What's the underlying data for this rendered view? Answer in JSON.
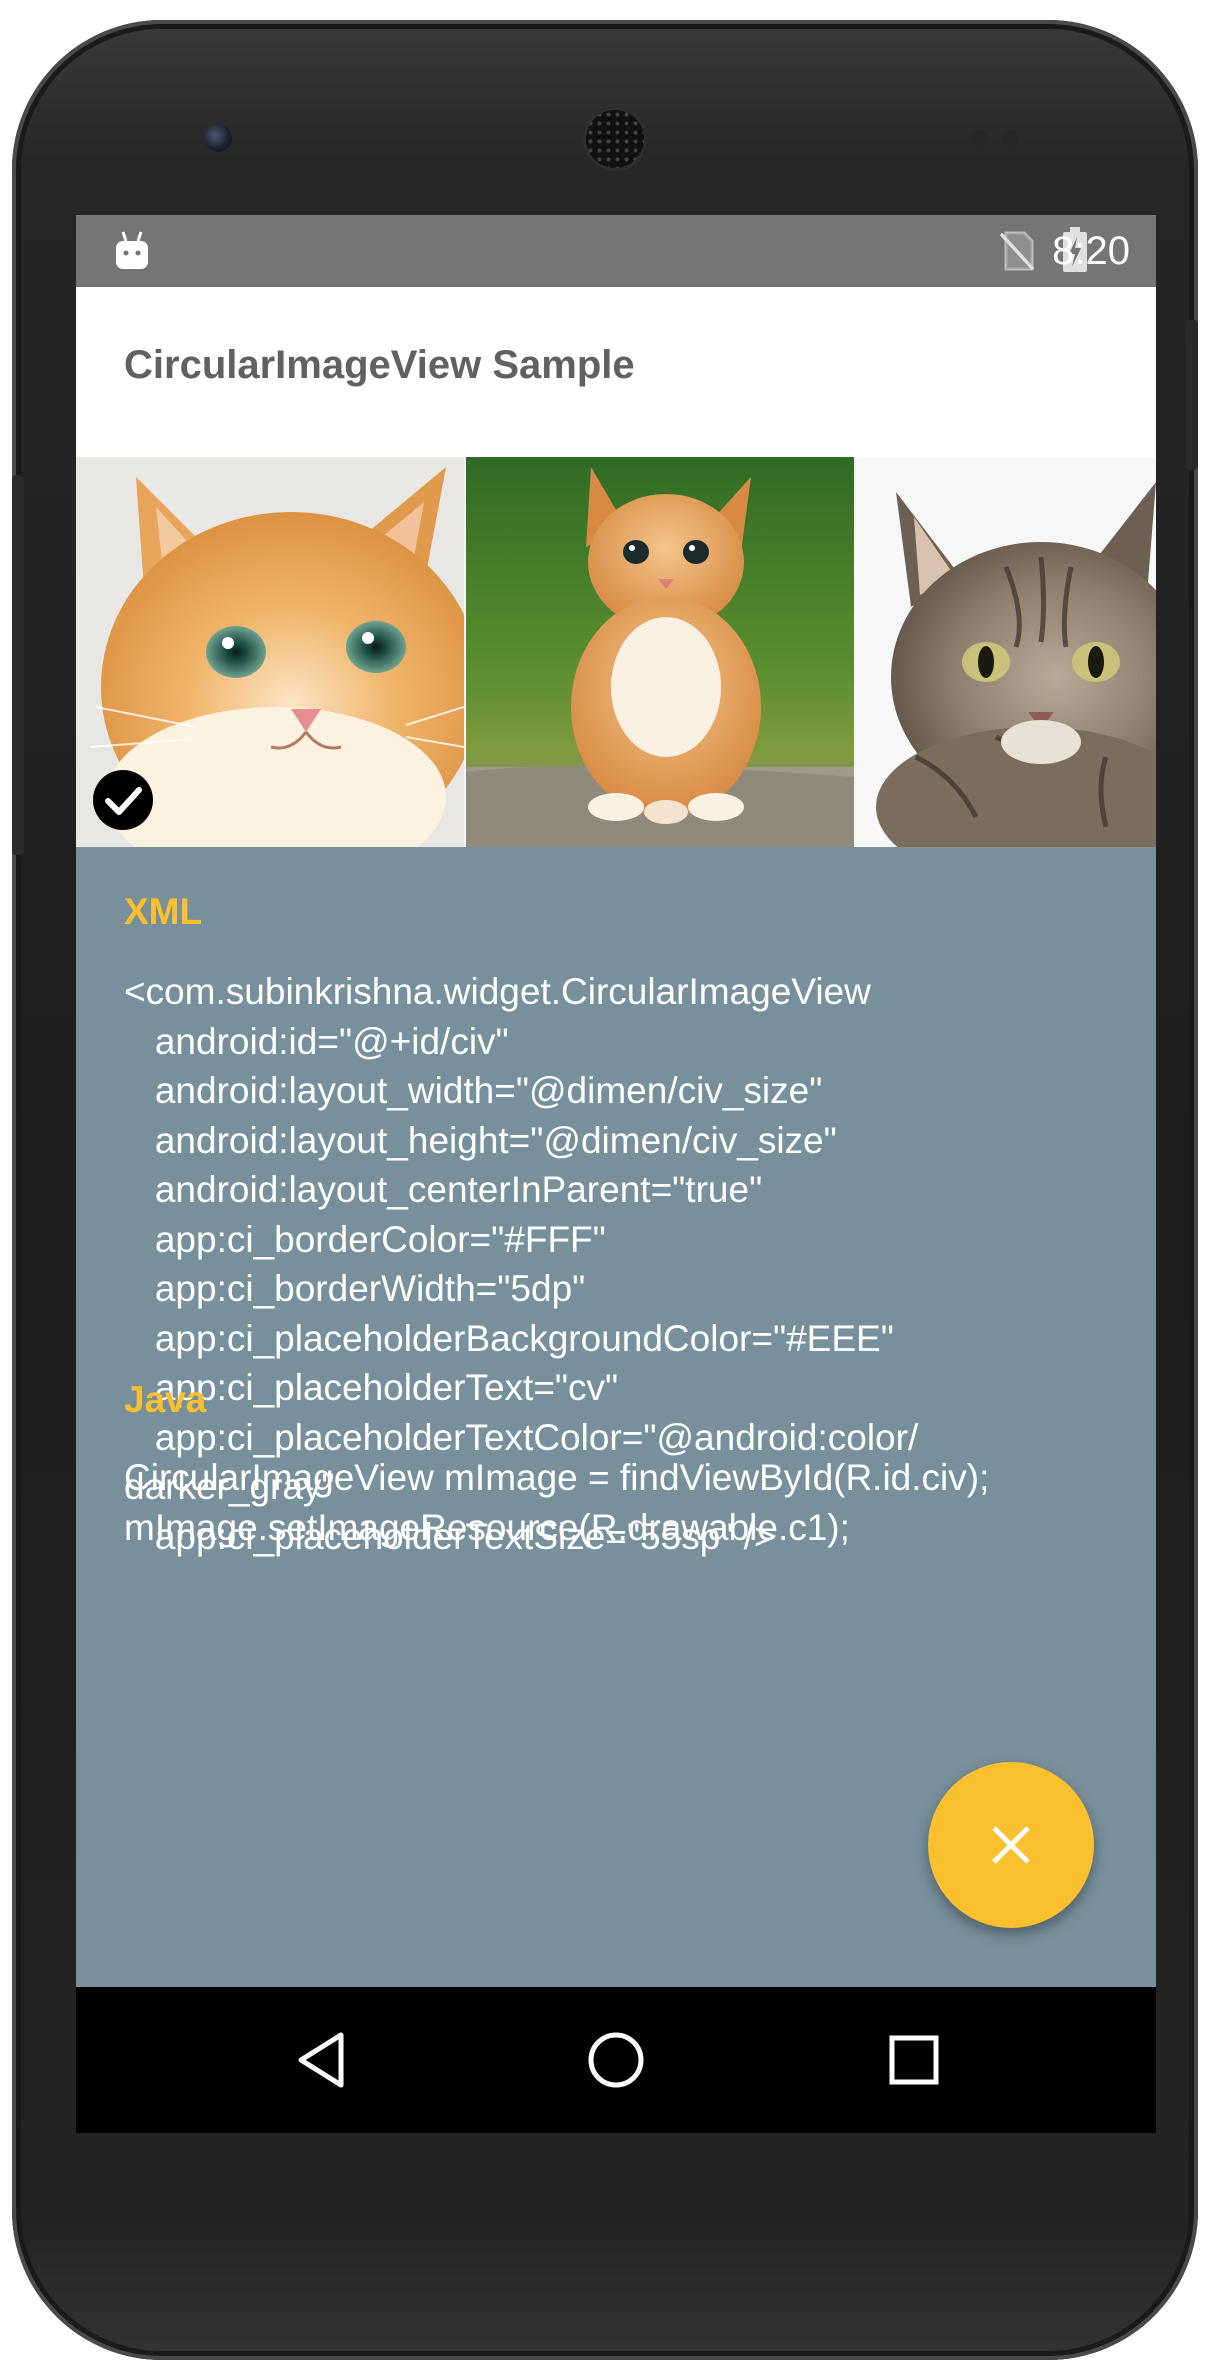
{
  "status_bar": {
    "time": "8:20"
  },
  "app_bar": {
    "title": "CircularImageView Sample"
  },
  "gallery": {
    "items": [
      {
        "subject": "orange kitten close-up",
        "selected": true
      },
      {
        "subject": "orange kitten sitting on grass",
        "selected": false
      },
      {
        "subject": "tabby cat",
        "selected": false
      }
    ]
  },
  "xml_section": {
    "title": "XML",
    "code": "<com.subinkrishna.widget.CircularImageView\n   android:id=\"@+id/civ\"\n   android:layout_width=\"@dimen/civ_size\"\n   android:layout_height=\"@dimen/civ_size\"\n   android:layout_centerInParent=\"true\"\n   app:ci_borderColor=\"#FFF\"\n   app:ci_borderWidth=\"5dp\"\n   app:ci_placeholderBackgroundColor=\"#EEE\"\n   app:ci_placeholderText=\"cv\"\n   app:ci_placeholderTextColor=\"@android:color/\ndarker_gray\"\n   app:ci_placeholderTextSize=\"55sp\" />"
  },
  "java_section": {
    "title": "Java",
    "code": "CircularImageView mImage = findViewById(R.id.civ);\nmImage.setImageResource(R.drawable.c1);"
  },
  "fab": {
    "icon": "close-icon"
  },
  "nav": {
    "back_icon": "back-icon",
    "home_icon": "home-icon",
    "recents_icon": "recents-icon"
  },
  "colors": {
    "status_bar": "#757575",
    "content_background": "#78909c",
    "accent": "#fbc02d",
    "title_text": "#616161"
  }
}
